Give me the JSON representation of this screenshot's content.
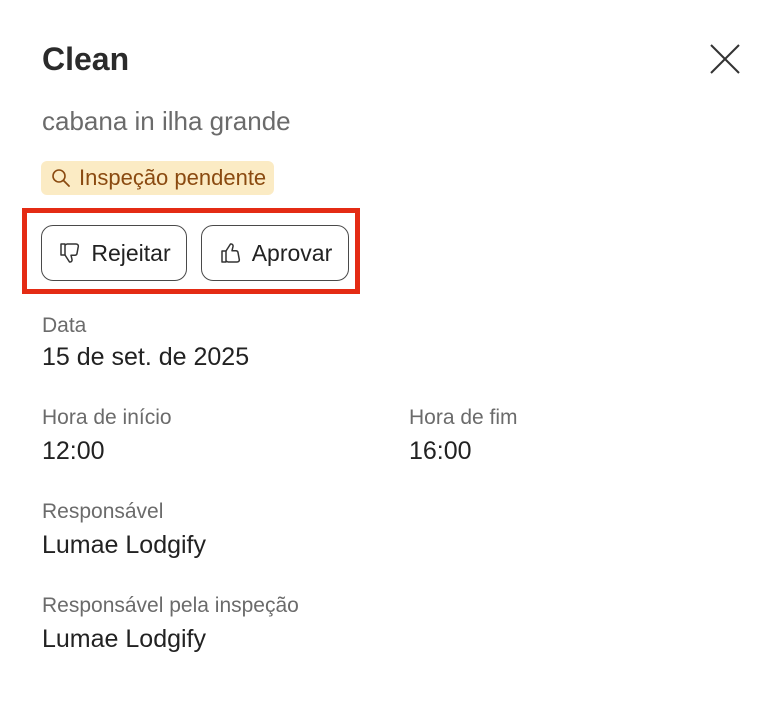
{
  "header": {
    "title": "Clean",
    "subtitle": "cabana in ilha grande"
  },
  "status": {
    "label": "Inspeção pendente",
    "icon": "search-icon",
    "background": "#fbebc4",
    "color": "#8a4a10"
  },
  "actions": {
    "reject_label": "Rejeitar",
    "reject_icon": "thumbs-down-icon",
    "approve_label": "Aprovar",
    "approve_icon": "thumbs-up-icon",
    "highlight_color": "#e42b14"
  },
  "details": {
    "date_label": "Data",
    "date_value": "15 de set. de 2025",
    "start_label": "Hora de início",
    "start_value": "12:00",
    "end_label": "Hora de fim",
    "end_value": "16:00",
    "responsible_label": "Responsável",
    "responsible_value": "Lumae Lodgify",
    "inspector_label": "Responsável pela inspeção",
    "inspector_value": "Lumae Lodgify"
  }
}
